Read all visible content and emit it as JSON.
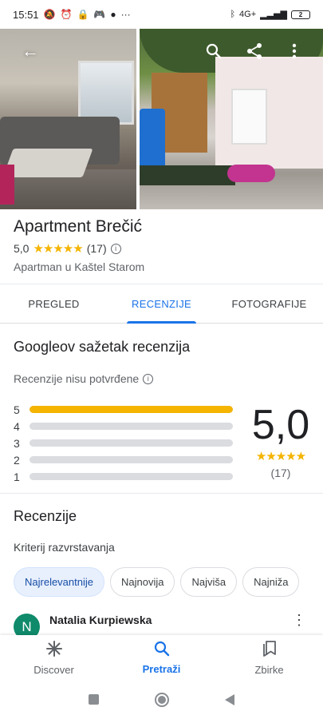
{
  "status_bar": {
    "time": "15:51",
    "battery": "2",
    "network": "4G+",
    "icons": [
      "muted-alarm-icon",
      "alarm-icon",
      "lock-icon",
      "game-icon",
      "dot-icon",
      "more-dots-icon",
      "bluetooth-icon",
      "signal-icon",
      "battery-icon"
    ]
  },
  "place": {
    "name": "Apartment Brečić",
    "rating": "5,0",
    "stars": "★★★★★",
    "review_count": "(17)",
    "subtitle": "Apartman u Kaštel Starom"
  },
  "tabs": [
    {
      "label": "PREGLED",
      "active": false
    },
    {
      "label": "RECENZIJE",
      "active": true
    },
    {
      "label": "FOTOGRAFIJE",
      "active": false
    }
  ],
  "summary": {
    "title": "Googleov sažetak recenzija",
    "unverified": "Recenzije nisu potvrđene",
    "score": "5,0",
    "stars": "★★★★★",
    "count": "(17)",
    "breakdown": [
      {
        "label": "5",
        "fraction": 1.0
      },
      {
        "label": "4",
        "fraction": 0.0
      },
      {
        "label": "3",
        "fraction": 0.0
      },
      {
        "label": "2",
        "fraction": 0.0
      },
      {
        "label": "1",
        "fraction": 0.0
      }
    ]
  },
  "reviews": {
    "title": "Recenzije",
    "sort_label": "Kriterij razvrstavanja",
    "chips": [
      {
        "label": "Najrelevantnije",
        "active": true
      },
      {
        "label": "Najnovija",
        "active": false
      },
      {
        "label": "Najviša",
        "active": false
      },
      {
        "label": "Najniža",
        "active": false
      }
    ],
    "first_reviewer": {
      "initial": "N",
      "name": "Natalia Kurpiewska",
      "avatar_color": "#0f8a6a"
    }
  },
  "bottom_nav": [
    {
      "label": "Discover",
      "icon": "asterisk-icon",
      "glyph": "✳",
      "active": false
    },
    {
      "label": "Pretraži",
      "icon": "search-icon",
      "glyph": "⚲",
      "active": true
    },
    {
      "label": "Zbirke",
      "icon": "bookmark-icon",
      "glyph": "⎘",
      "active": false
    }
  ],
  "colors": {
    "accent": "#1a73e8",
    "star": "#f4b400",
    "bar_track": "#dadce0"
  }
}
